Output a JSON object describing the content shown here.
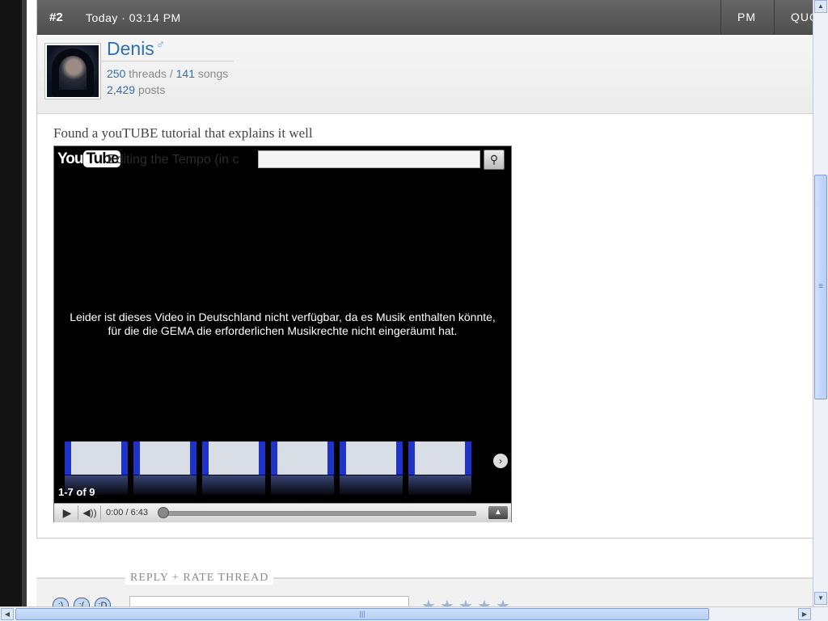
{
  "post": {
    "number": "#2",
    "date": "Today · 03:14 PM",
    "buttons": {
      "pm": "PM",
      "quote": "QUOTE"
    }
  },
  "user": {
    "name": "Denis",
    "gender_symbol": "♂",
    "threads_count": "250",
    "threads_label": "threads",
    "separator": "/",
    "songs_count": "141",
    "songs_label": "songs",
    "posts_count": "2,429",
    "posts_label": "posts"
  },
  "message": {
    "text": "Found a youTUBE tutorial that explains it well"
  },
  "video": {
    "logo_you": "You",
    "logo_tube": "Tube",
    "title_ghost": "Editing the Tempo (in c",
    "search_icon": "search-icon",
    "unavailable_text": "Leider ist dieses Video in Deutschland nicht verfügbar, da es Musik enthalten könnte, für die die GEMA die erforderlichen Musikrechte nicht eingeräumt hat.",
    "playlist_count": "1-7 of 9",
    "time": "0:00 / 6:43",
    "progress": 0.0
  },
  "reply": {
    "title": "REPLY + RATE THREAD"
  },
  "colors": {
    "link": "#2f6fb0",
    "header_bg": "#555555",
    "scroll_thumb": "#b6cff5"
  }
}
